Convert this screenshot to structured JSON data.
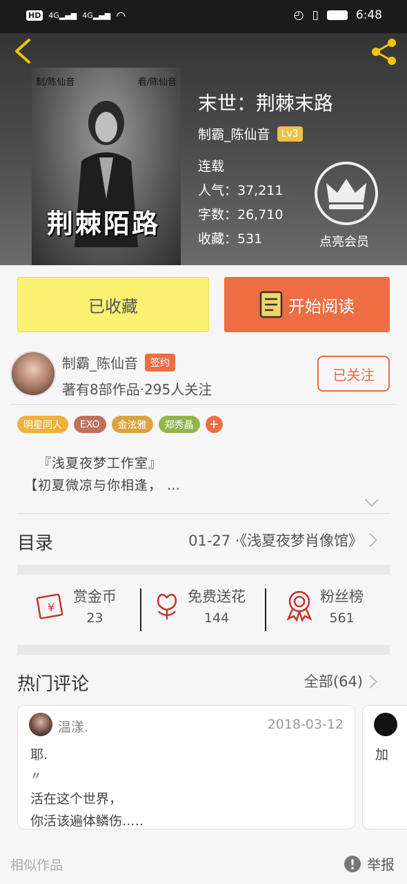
{
  "status_bar": {
    "network": "HD",
    "signal1": "4G",
    "signal2": "4G",
    "time": "6:48"
  },
  "book": {
    "title": "末世：荆棘末路",
    "author": "制霸_陈仙音",
    "level": "Lv3",
    "status": "连载",
    "popularity": "人气：37,211",
    "word_count": "字数：26,710",
    "favorites": "收藏：531",
    "member_label": "点亮会员",
    "cover_caption_left": "制/陈仙音",
    "cover_caption_right": "看/陈仙音",
    "cover_title": "荆棘陌路"
  },
  "actions": {
    "favorited_label": "已收藏",
    "read_label": "开始阅读"
  },
  "author_info": {
    "name": "制霸_陈仙音",
    "badge": "签约",
    "stats": "著有8部作品·295人关注",
    "follow_label": "已关注"
  },
  "tags": [
    {
      "label": "明星同人",
      "color": "#f2b03c"
    },
    {
      "label": "EXO",
      "color": "#c0715a"
    },
    {
      "label": "金泫雅",
      "color": "#d9a43c"
    },
    {
      "label": "郑秀晶",
      "color": "#93b54c"
    }
  ],
  "tag_more": "+",
  "description": {
    "line1": "『浅夏夜梦工作室』",
    "line2": "【初夏微凉与你相逢，  …"
  },
  "toc": {
    "title": "目录",
    "latest": "01-27 ·《浅夏夜梦肖像馆》"
  },
  "stats": [
    {
      "label": "赏金币",
      "value": "23",
      "icon": "envelope-yen-icon"
    },
    {
      "label": "免费送花",
      "value": "144",
      "icon": "flower-icon"
    },
    {
      "label": "粉丝榜",
      "value": "561",
      "icon": "medal-icon"
    }
  ],
  "comments": {
    "title": "热门评论",
    "all_label": "全部(64)",
    "items": [
      {
        "user": "温漾.",
        "date": "2018-03-12",
        "lines": [
          "耶.",
          "〃",
          "活在这个世界，",
          "你活该遍体鳞伤.…."
        ]
      },
      {
        "preview": "加"
      }
    ]
  },
  "footer": {
    "similar": "相似作品",
    "report": "举报"
  },
  "colors": {
    "accent": "#ef6d43",
    "favorite_bg": "#fbf173",
    "hero_bg": "#4a4a4a"
  }
}
